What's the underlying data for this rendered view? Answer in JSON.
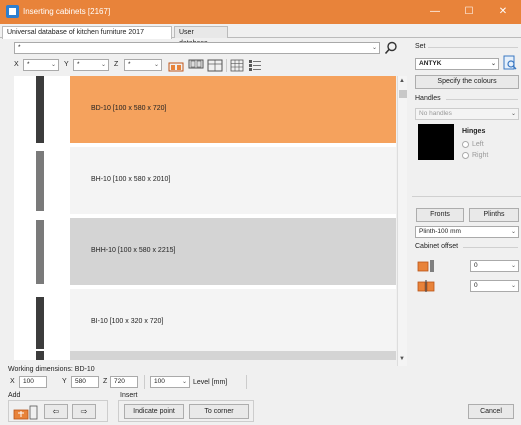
{
  "window": {
    "title": "Inserting cabinets [2167]",
    "minimize": "—",
    "maximize": "☐",
    "close": "✕"
  },
  "tabs": [
    {
      "label": "Universal database of kitchen furniture 2017",
      "active": true
    },
    {
      "label": "User database",
      "active": false
    }
  ],
  "filter": {
    "main_value": "*",
    "x_label": "X",
    "x_value": "*",
    "y_label": "Y",
    "y_value": "*",
    "z_label": "Z",
    "z_value": "*"
  },
  "items": [
    {
      "label": "BD-10  [100 x 580 x 720]",
      "selected": true
    },
    {
      "label": "BH-10  [100 x 580 x 2010]",
      "selected": false
    },
    {
      "label": "BHH-10  [100 x 580 x 2215]",
      "selected": false
    },
    {
      "label": "BI-10  [100 x 320 x 720]",
      "selected": false
    }
  ],
  "set_panel": {
    "set_label": "Set",
    "set_value": "ANTYK",
    "colours_button": "Specify the colours",
    "handles_label": "Handles",
    "handles_value": "No handles",
    "hinges_label": "Hinges",
    "hinge_left": "Left",
    "hinge_right": "Right",
    "fronts_button": "Fronts",
    "plinths_button": "Plinths",
    "plinth_value": "Plinth-100 mm",
    "offset_label": "Cabinet offset",
    "offset1_value": "0",
    "offset2_value": "0"
  },
  "working": {
    "label": "Working dimensions: BD-10",
    "x_label": "X",
    "x_value": "100",
    "y_label": "Y",
    "y_value": "580",
    "z_label": "Z",
    "z_value": "720",
    "level_value": "100",
    "level_label": "Level [mm]"
  },
  "add_group": {
    "label": "Add"
  },
  "insert_group": {
    "label": "Insert",
    "indicate_button": "Indicate point",
    "corner_button": "To corner"
  },
  "cancel_button": "Cancel",
  "colors": {
    "titlebar": "#e8833a",
    "selected_row": "#f5a25d",
    "row_alt": "#d4d4d4",
    "row_white": "#f4f4f4"
  }
}
